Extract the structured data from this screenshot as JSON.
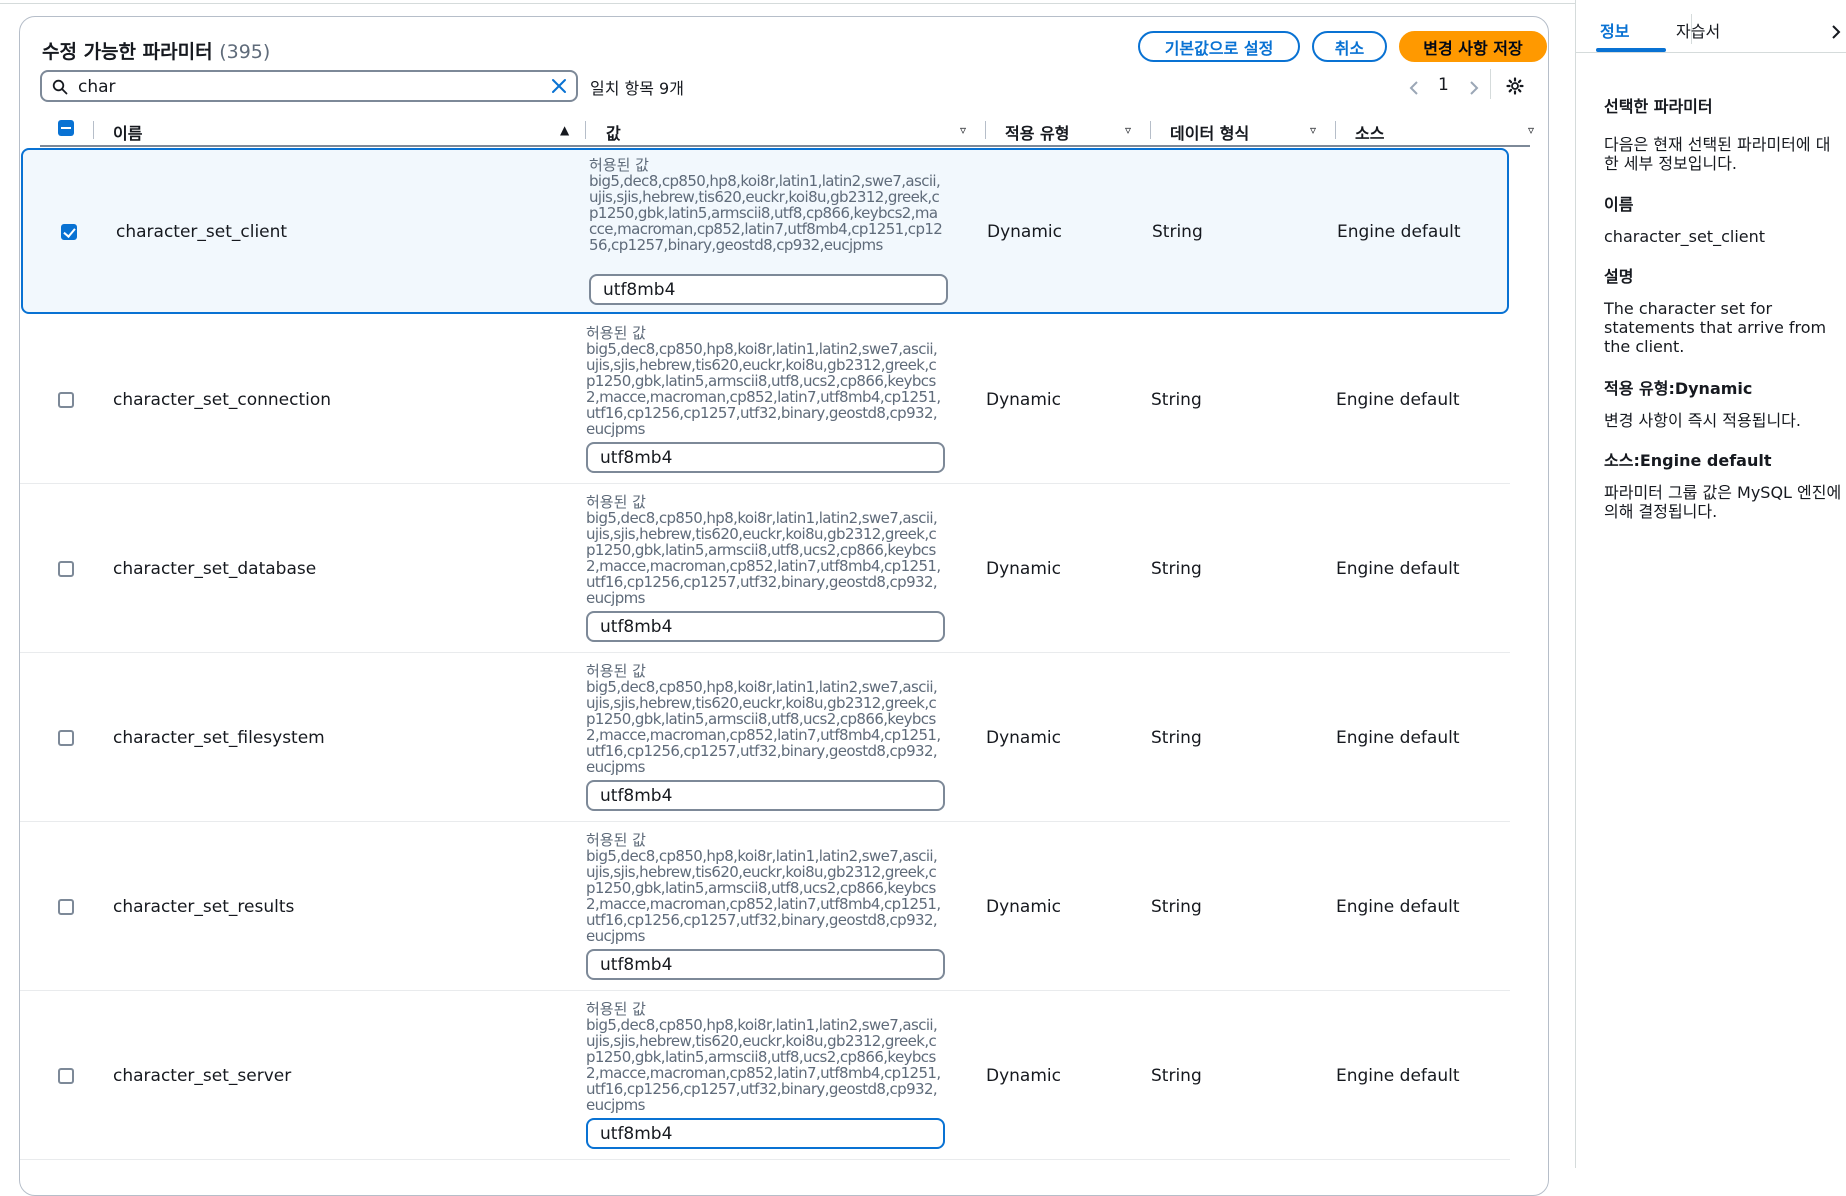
{
  "panel": {
    "title": "수정 가능한 파라미터",
    "count": "(395)",
    "reset_label": "기본값으로 설정",
    "cancel_label": "취소",
    "save_label": "변경 사항 저장"
  },
  "search": {
    "value": "char",
    "match_text": "일치 항목 9개"
  },
  "pagination": {
    "current_page": "1"
  },
  "columns": {
    "name": "이름",
    "value": "값",
    "apply_type": "적용 유형",
    "data_type": "데이터 형식",
    "source": "소스"
  },
  "allowed_label": "허용된 값",
  "rows": [
    {
      "name": "character_set_client",
      "allowed": "big5,dec8,cp850,hp8,koi8r,latin1,latin2,swe7,ascii,ujis,sjis,hebrew,tis620,euckr,koi8u,gb2312,greek,cp1250,gbk,latin5,armscii8,utf8,cp866,keybcs2,macce,macroman,cp852,latin7,utf8mb4,cp1251,cp1256,cp1257,binary,geostd8,cp932,eucjpms",
      "value": "utf8mb4",
      "apply_type": "Dynamic",
      "data_type": "String",
      "source": "Engine default",
      "checked": true
    },
    {
      "name": "character_set_connection",
      "allowed": "big5,dec8,cp850,hp8,koi8r,latin1,latin2,swe7,ascii,ujis,sjis,hebrew,tis620,euckr,koi8u,gb2312,greek,cp1250,gbk,latin5,armscii8,utf8,ucs2,cp866,keybcs2,macce,macroman,cp852,latin7,utf8mb4,cp1251,utf16,cp1256,cp1257,utf32,binary,geostd8,cp932,eucjpms",
      "value": "utf8mb4",
      "apply_type": "Dynamic",
      "data_type": "String",
      "source": "Engine default",
      "checked": false
    },
    {
      "name": "character_set_database",
      "allowed": "big5,dec8,cp850,hp8,koi8r,latin1,latin2,swe7,ascii,ujis,sjis,hebrew,tis620,euckr,koi8u,gb2312,greek,cp1250,gbk,latin5,armscii8,utf8,ucs2,cp866,keybcs2,macce,macroman,cp852,latin7,utf8mb4,cp1251,utf16,cp1256,cp1257,utf32,binary,geostd8,cp932,eucjpms",
      "value": "utf8mb4",
      "apply_type": "Dynamic",
      "data_type": "String",
      "source": "Engine default",
      "checked": false
    },
    {
      "name": "character_set_filesystem",
      "allowed": "big5,dec8,cp850,hp8,koi8r,latin1,latin2,swe7,ascii,ujis,sjis,hebrew,tis620,euckr,koi8u,gb2312,greek,cp1250,gbk,latin5,armscii8,utf8,ucs2,cp866,keybcs2,macce,macroman,cp852,latin7,utf8mb4,cp1251,utf16,cp1256,cp1257,utf32,binary,geostd8,cp932,eucjpms",
      "value": "utf8mb4",
      "apply_type": "Dynamic",
      "data_type": "String",
      "source": "Engine default",
      "checked": false
    },
    {
      "name": "character_set_results",
      "allowed": "big5,dec8,cp850,hp8,koi8r,latin1,latin2,swe7,ascii,ujis,sjis,hebrew,tis620,euckr,koi8u,gb2312,greek,cp1250,gbk,latin5,armscii8,utf8,ucs2,cp866,keybcs2,macce,macroman,cp852,latin7,utf8mb4,cp1251,utf16,cp1256,cp1257,utf32,binary,geostd8,cp932,eucjpms",
      "value": "utf8mb4",
      "apply_type": "Dynamic",
      "data_type": "String",
      "source": "Engine default",
      "checked": false
    },
    {
      "name": "character_set_server",
      "allowed": "big5,dec8,cp850,hp8,koi8r,latin1,latin2,swe7,ascii,ujis,sjis,hebrew,tis620,euckr,koi8u,gb2312,greek,cp1250,gbk,latin5,armscii8,utf8,ucs2,cp866,keybcs2,macce,macroman,cp852,latin7,utf8mb4,cp1251,utf16,cp1256,cp1257,utf32,binary,geostd8,cp932,eucjpms",
      "value": "utf8mb4",
      "apply_type": "Dynamic",
      "data_type": "String",
      "source": "Engine default",
      "checked": false
    }
  ],
  "side_panel": {
    "tab_info": "정보",
    "tab_tutorial": "자습서",
    "heading": "선택한 파라미터",
    "intro": "다음은 현재 선택된 파라미터에 대한 세부 정보입니다.",
    "name_label": "이름",
    "name_value": "character_set_client",
    "desc_label": "설명",
    "desc_value": "The character set for statements that arrive from the client.",
    "apply_label": "적용 유형:Dynamic",
    "apply_value": "변경 사항이 즉시 적용됩니다.",
    "source_label": "소스:Engine default",
    "source_value": "파라미터 그룹 값은 MySQL 엔진에 의해 결정됩니다."
  },
  "colors": {
    "accent": "#0972d3",
    "primary_button": "#ff9900",
    "selected_row_bg": "#f2f8fd"
  }
}
